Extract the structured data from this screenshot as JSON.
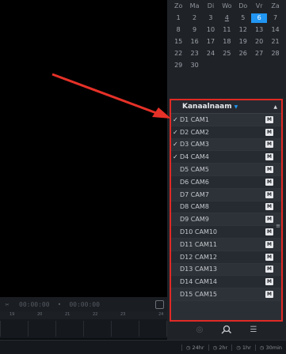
{
  "calendar": {
    "weekdays": [
      "Zo",
      "Ma",
      "Di",
      "Wo",
      "Do",
      "Vr",
      "Za"
    ],
    "weeks": [
      [
        "1",
        "2",
        "3",
        "4",
        "5",
        "6",
        "7"
      ],
      [
        "8",
        "9",
        "10",
        "11",
        "12",
        "13",
        "14"
      ],
      [
        "15",
        "16",
        "17",
        "18",
        "19",
        "20",
        "21"
      ],
      [
        "22",
        "23",
        "24",
        "25",
        "26",
        "27",
        "28"
      ],
      [
        "29",
        "30",
        "",
        "",
        "",
        "",
        ""
      ]
    ],
    "selected_day": "6",
    "today": "4",
    "accent_color": "#2196f3"
  },
  "channels": {
    "header": "Kanaalnaam",
    "highlight_color": "#e02a25",
    "items": [
      {
        "label": "D1 CAM1",
        "checked": true
      },
      {
        "label": "D2 CAM2",
        "checked": true
      },
      {
        "label": "D3 CAM3",
        "checked": true
      },
      {
        "label": "D4 CAM4",
        "checked": true
      },
      {
        "label": "D5 CAM5",
        "checked": false
      },
      {
        "label": "D6 CAM6",
        "checked": false
      },
      {
        "label": "D7 CAM7",
        "checked": false
      },
      {
        "label": "D8 CAM8",
        "checked": false
      },
      {
        "label": "D9 CAM9",
        "checked": false
      },
      {
        "label": "D10 CAM10",
        "checked": false
      },
      {
        "label": "D11 CAM11",
        "checked": false
      },
      {
        "label": "D12 CAM12",
        "checked": false
      },
      {
        "label": "D13 CAM13",
        "checked": false
      },
      {
        "label": "D14 CAM14",
        "checked": false
      },
      {
        "label": "D15 CAM15",
        "checked": false
      }
    ],
    "badge": "M"
  },
  "playbar": {
    "start": "00:00:00",
    "end": "00:00:00"
  },
  "timeline": {
    "ticks": [
      "19",
      "20",
      "21",
      "22",
      "23",
      "24"
    ]
  },
  "zoom": {
    "options": [
      "24hr",
      "2hr",
      "1hr",
      "30min"
    ]
  }
}
